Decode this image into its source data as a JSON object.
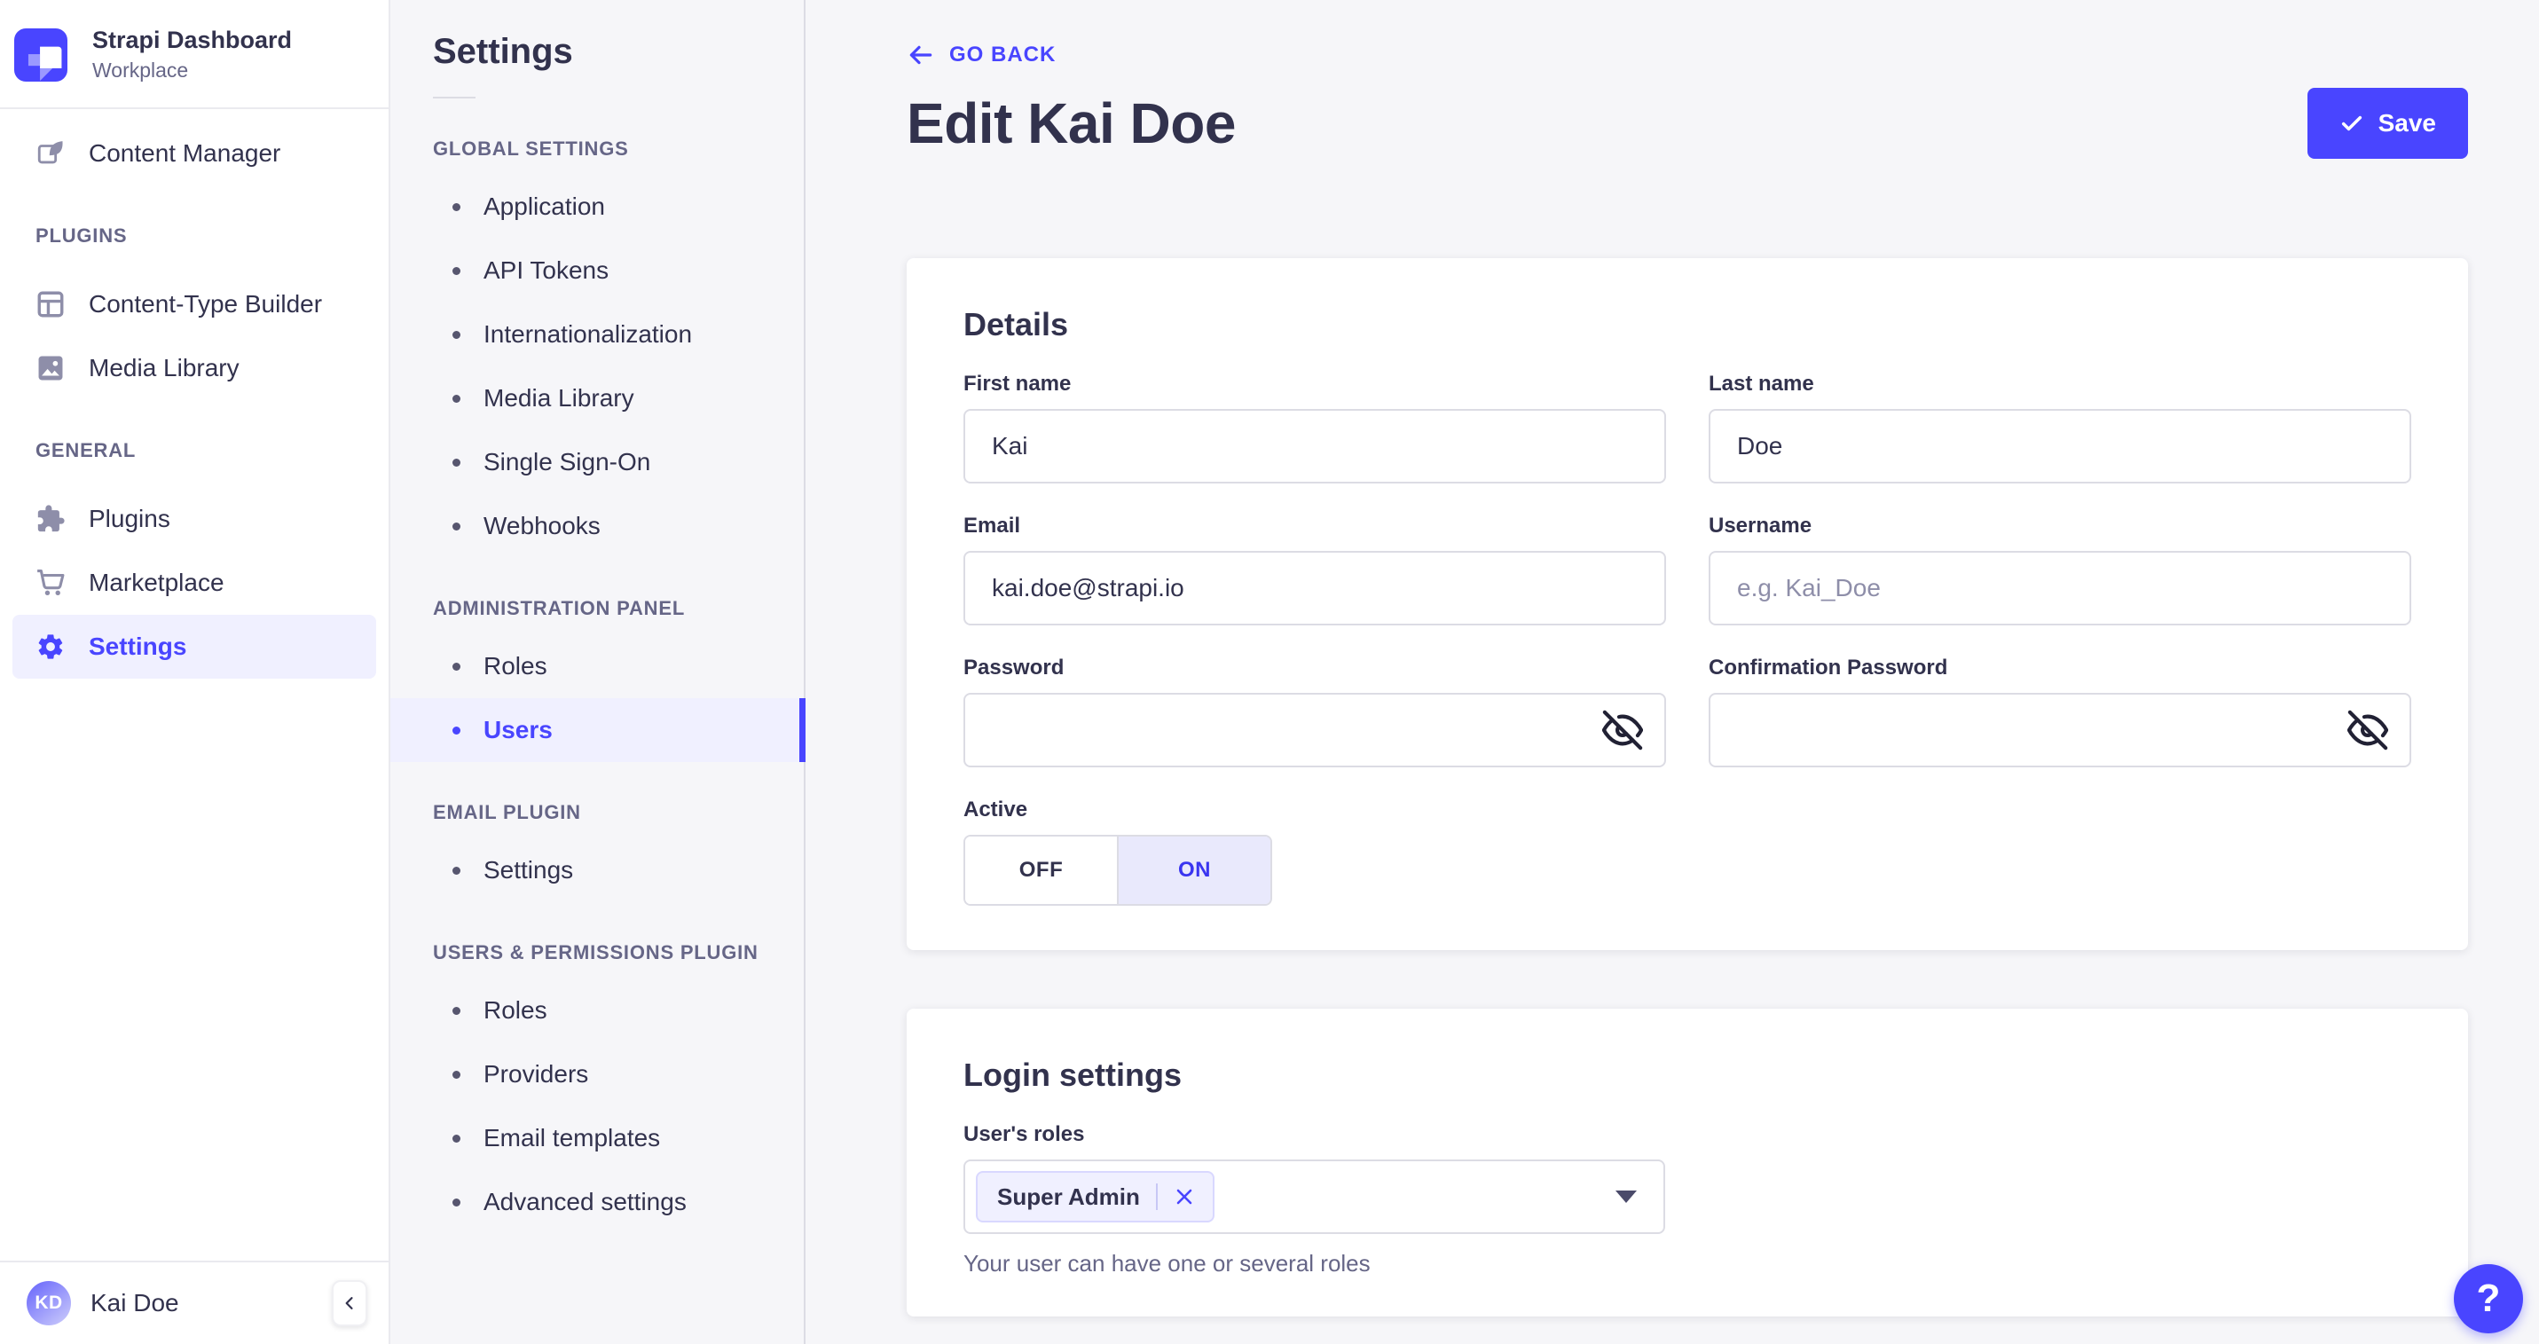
{
  "colors": {
    "accent": "#4945ff",
    "accent_light": "#f0f0ff",
    "text_dark": "#32324d",
    "text_muted": "#666687",
    "border": "#dcdce4",
    "background": "#f6f6f9"
  },
  "brand": {
    "title": "Strapi Dashboard",
    "subtitle": "Workplace"
  },
  "sidebar": {
    "items": [
      {
        "label": "Content Manager",
        "icon": "pen-icon"
      }
    ],
    "sections": [
      {
        "header": "PLUGINS",
        "items": [
          {
            "label": "Content-Type Builder",
            "icon": "layout-icon"
          },
          {
            "label": "Media Library",
            "icon": "image-icon"
          }
        ]
      },
      {
        "header": "GENERAL",
        "items": [
          {
            "label": "Plugins",
            "icon": "puzzle-icon"
          },
          {
            "label": "Marketplace",
            "icon": "cart-icon"
          },
          {
            "label": "Settings",
            "icon": "gear-icon",
            "active": true
          }
        ]
      }
    ],
    "user": {
      "initials": "KD",
      "name": "Kai Doe"
    }
  },
  "subnav": {
    "title": "Settings",
    "sections": [
      {
        "header": "GLOBAL SETTINGS",
        "items": [
          "Application",
          "API Tokens",
          "Internationalization",
          "Media Library",
          "Single Sign-On",
          "Webhooks"
        ]
      },
      {
        "header": "ADMINISTRATION PANEL",
        "items": [
          "Roles",
          "Users"
        ],
        "active_item": "Users"
      },
      {
        "header": "EMAIL PLUGIN",
        "items": [
          "Settings"
        ]
      },
      {
        "header": "USERS & PERMISSIONS PLUGIN",
        "items": [
          "Roles",
          "Providers",
          "Email templates",
          "Advanced settings"
        ]
      }
    ]
  },
  "header": {
    "back_label": "GO BACK",
    "title": "Edit Kai Doe",
    "save_label": "Save"
  },
  "details": {
    "heading": "Details",
    "fields": {
      "first_name": {
        "label": "First name",
        "value": "Kai"
      },
      "last_name": {
        "label": "Last name",
        "value": "Doe"
      },
      "email": {
        "label": "Email",
        "value": "kai.doe@strapi.io"
      },
      "username": {
        "label": "Username",
        "value": "",
        "placeholder": "e.g. Kai_Doe"
      },
      "password": {
        "label": "Password",
        "value": ""
      },
      "confirm_password": {
        "label": "Confirmation Password",
        "value": ""
      }
    },
    "active_toggle": {
      "label": "Active",
      "off": "OFF",
      "on": "ON",
      "value": "ON"
    }
  },
  "login": {
    "heading": "Login settings",
    "roles": {
      "label": "User's roles",
      "selected": [
        "Super Admin"
      ],
      "helper": "Your user can have one or several roles"
    }
  },
  "help": {
    "label": "?"
  }
}
